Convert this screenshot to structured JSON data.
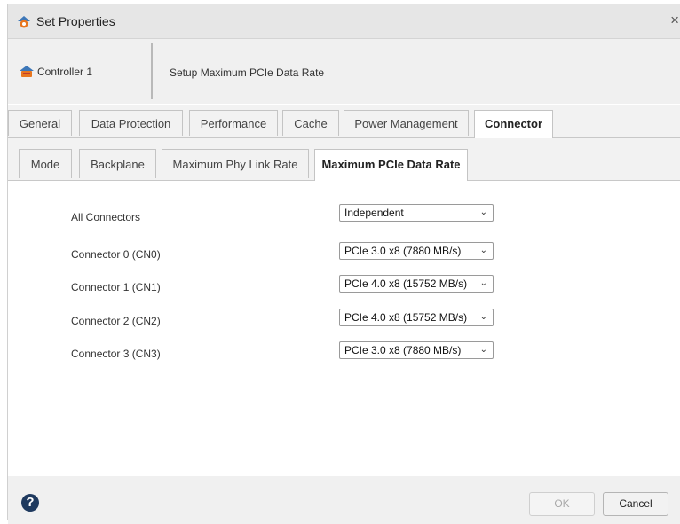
{
  "window": {
    "title": "Set Properties",
    "close_symbol": "×"
  },
  "infobar": {
    "controller_name": "Controller 1",
    "description": "Setup Maximum PCIe Data Rate"
  },
  "tabs": [
    {
      "label": "General"
    },
    {
      "label": "Data Protection"
    },
    {
      "label": "Performance"
    },
    {
      "label": "Cache"
    },
    {
      "label": "Power Management"
    },
    {
      "label": "Connector",
      "active": true
    }
  ],
  "subtabs": [
    {
      "label": "Mode"
    },
    {
      "label": "Backplane"
    },
    {
      "label": "Maximum Phy Link Rate"
    },
    {
      "label": "Maximum PCIe Data Rate",
      "active": true
    }
  ],
  "settings": [
    {
      "label": "All Connectors",
      "value": "Independent"
    },
    {
      "label": "Connector 0 (CN0)",
      "value": "PCIe 3.0 x8 (7880 MB/s)"
    },
    {
      "label": "Connector 1 (CN1)",
      "value": "PCIe 4.0 x8 (15752 MB/s)"
    },
    {
      "label": "Connector 2 (CN2)",
      "value": "PCIe 4.0 x8 (15752 MB/s)"
    },
    {
      "label": "Connector 3 (CN3)",
      "value": "PCIe 3.0 x8 (7880 MB/s)"
    }
  ],
  "footer": {
    "help_symbol": "?",
    "ok_label": "OK",
    "ok_enabled": false,
    "cancel_label": "Cancel"
  },
  "colors": {
    "help_bg": "#1f3a5f",
    "title_bg": "#e6e6e6",
    "icon_orange": "#e8761f"
  }
}
